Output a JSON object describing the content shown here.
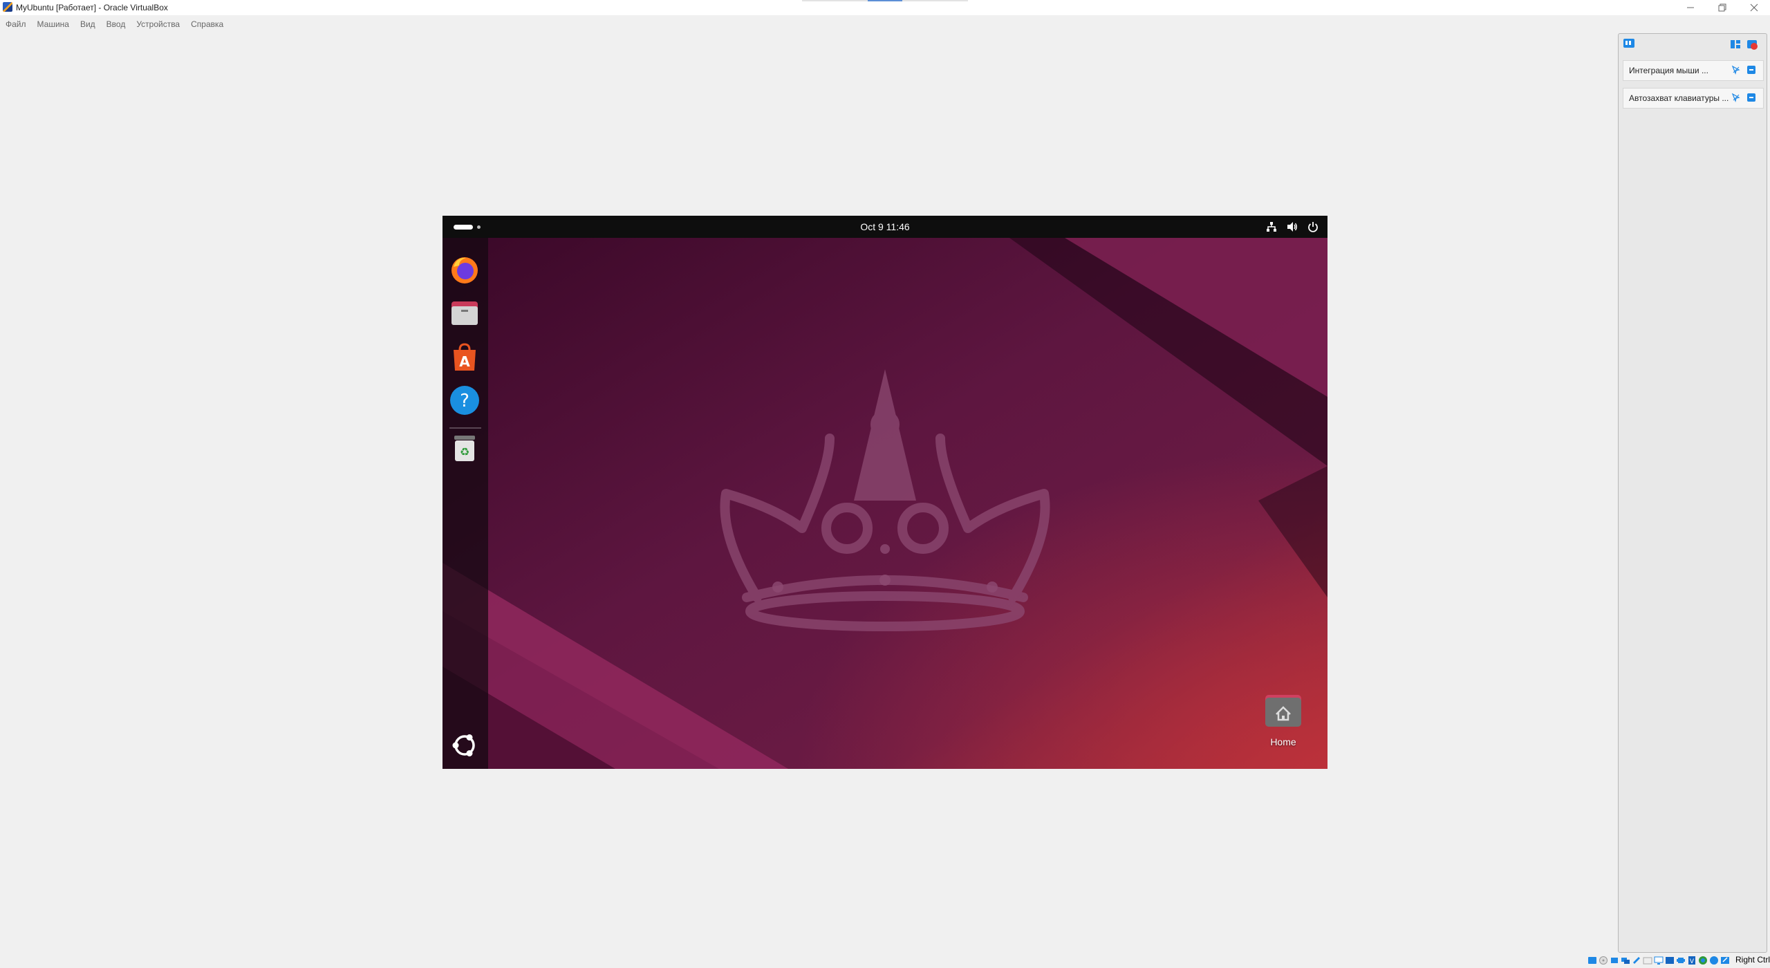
{
  "window": {
    "title": "MyUbuntu [Работает] - Oracle VirtualBox",
    "app_icon": "virtualbox-icon",
    "controls": [
      "minimize-icon",
      "restore-icon",
      "close-icon"
    ]
  },
  "menu": {
    "items": [
      "Файл",
      "Машина",
      "Вид",
      "Ввод",
      "Устройства",
      "Справка"
    ]
  },
  "guest": {
    "topbar": {
      "clock": "Oct 9  11:46",
      "tray_icons": [
        "network-icon",
        "volume-icon",
        "power-icon"
      ]
    },
    "dock": {
      "apps": [
        {
          "name": "Firefox",
          "icon": "firefox-icon"
        },
        {
          "name": "Files",
          "icon": "files-icon"
        },
        {
          "name": "App Center",
          "icon": "app-center-icon"
        },
        {
          "name": "Help",
          "icon": "help-icon"
        },
        {
          "name": "Trash",
          "icon": "trash-icon"
        }
      ],
      "show_apps_icon": "ubuntu-logo-icon"
    },
    "desktop": {
      "home_label": "Home"
    },
    "colors": {
      "wallpaper_dark": "#3d0a2c",
      "wallpaper_mid": "#6a1a48",
      "wallpaper_accent": "#b0303a"
    }
  },
  "notifications": {
    "entries": [
      {
        "label": "Интеграция мыши ..."
      },
      {
        "label": "Автозахват клавиатуры ..."
      }
    ]
  },
  "statusbar": {
    "host_key": "Right Ctrl"
  }
}
